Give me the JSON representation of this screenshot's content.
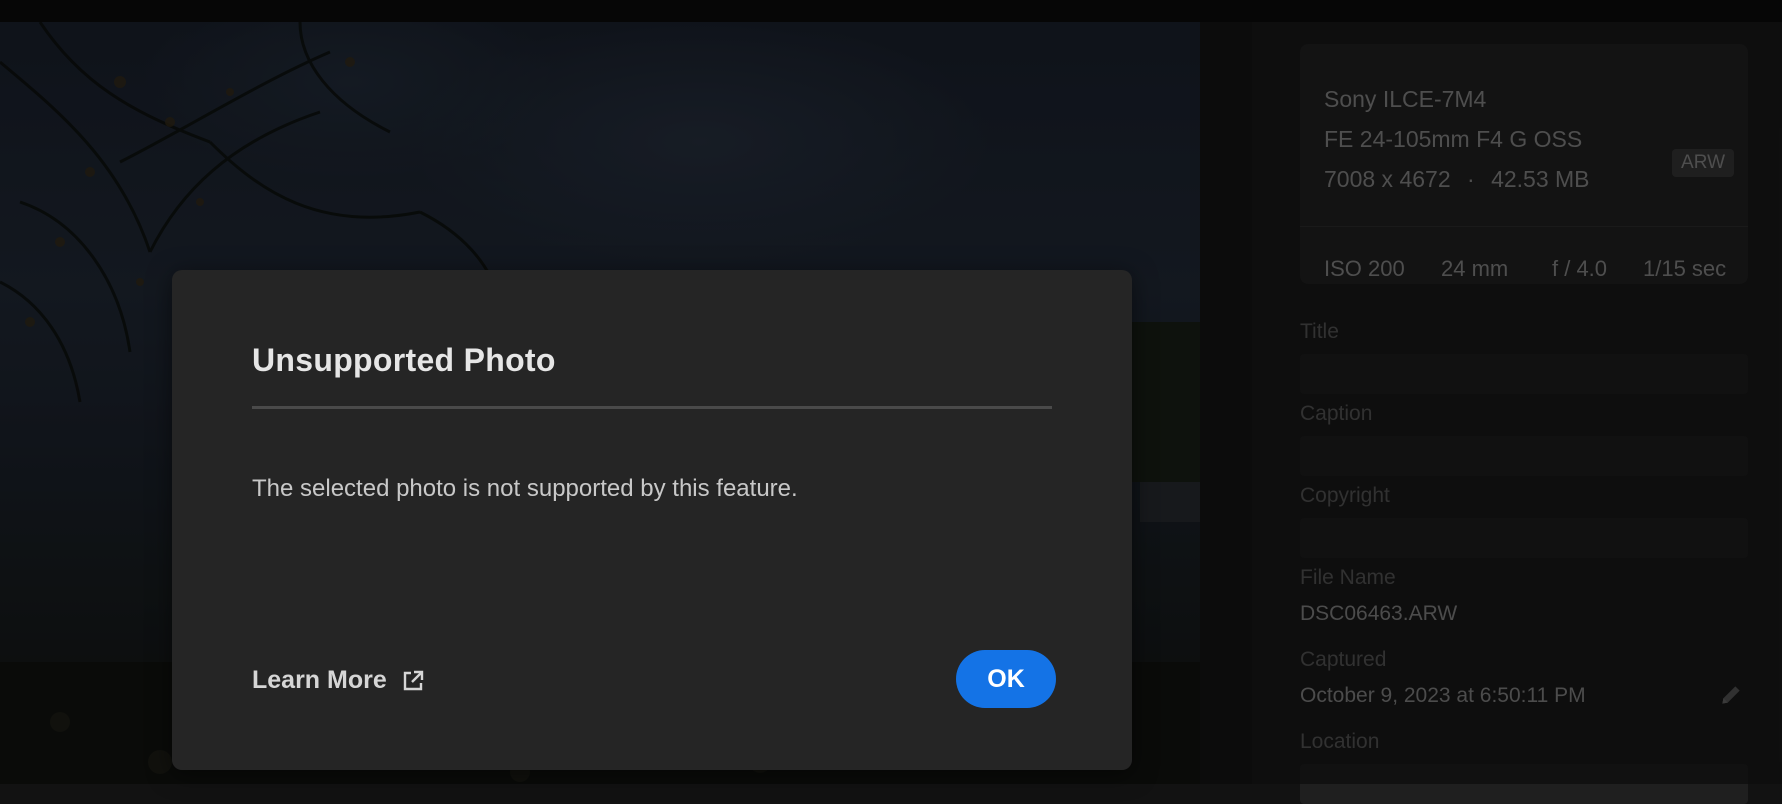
{
  "colors": {
    "accent": "#1473e6",
    "dialog_bg": "#252525",
    "panel_bg": "#1b1b1b"
  },
  "info_panel": {
    "camera": "Sony ILCE-7M4",
    "lens": "FE 24-105mm F4 G OSS",
    "dimensions": "7008 x 4672",
    "separator": "·",
    "file_size": "42.53 MB",
    "format_badge": "ARW",
    "iso": "ISO 200",
    "focal_length": "24 mm",
    "aperture": "f / 4.0",
    "shutter": "1/15 sec",
    "title_label": "Title",
    "caption_label": "Caption",
    "copyright_label": "Copyright",
    "file_name_label": "File Name",
    "file_name": "DSC06463.ARW",
    "captured_label": "Captured",
    "captured": "October 9, 2023 at 6:50:11 PM",
    "location_label": "Location",
    "edit_icon": "pencil-icon"
  },
  "dialog": {
    "title": "Unsupported Photo",
    "message": "The selected photo is not supported by this feature.",
    "learn_more": "Learn More",
    "learn_more_icon": "external-link-icon",
    "ok": "OK"
  }
}
